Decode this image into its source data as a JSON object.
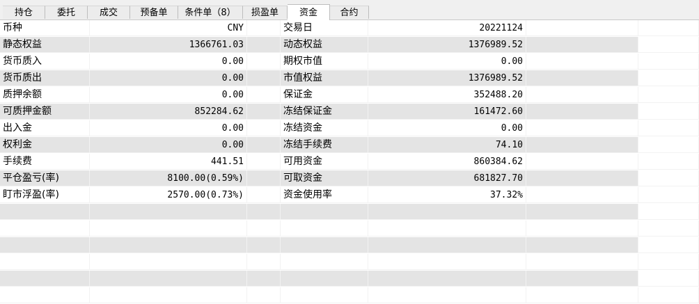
{
  "tabs": [
    {
      "label": "持仓",
      "active": false
    },
    {
      "label": "委托",
      "active": false
    },
    {
      "label": "成交",
      "active": false
    },
    {
      "label": "预备单",
      "active": false
    },
    {
      "label": "条件单（8）",
      "active": false
    },
    {
      "label": "损盈单",
      "active": false
    },
    {
      "label": "资金",
      "active": true
    },
    {
      "label": "合约",
      "active": false
    }
  ],
  "funds": {
    "rows": [
      {
        "l1": "币种",
        "v1": "CNY",
        "l2": "交易日",
        "v2": "20221124"
      },
      {
        "l1": "静态权益",
        "v1": "1366761.03",
        "l2": "动态权益",
        "v2": "1376989.52"
      },
      {
        "l1": "货币质入",
        "v1": "0.00",
        "l2": "期权市值",
        "v2": "0.00"
      },
      {
        "l1": "货币质出",
        "v1": "0.00",
        "l2": "市值权益",
        "v2": "1376989.52"
      },
      {
        "l1": "质押余额",
        "v1": "0.00",
        "l2": "保证金",
        "v2": "352488.20"
      },
      {
        "l1": "可质押金额",
        "v1": "852284.62",
        "l2": "冻结保证金",
        "v2": "161472.60"
      },
      {
        "l1": "出入金",
        "v1": "0.00",
        "l2": "冻结资金",
        "v2": "0.00"
      },
      {
        "l1": "权利金",
        "v1": "0.00",
        "l2": "冻结手续费",
        "v2": "74.10"
      },
      {
        "l1": "手续费",
        "v1": "441.51",
        "l2": "可用资金",
        "v2": "860384.62"
      },
      {
        "l1": "平仓盈亏(率)",
        "v1": "8100.00(0.59%)",
        "l2": "可取资金",
        "v2": "681827.70"
      },
      {
        "l1": "盯市浮盈(率)",
        "v1": "2570.00(0.73%)",
        "l2": "资金使用率",
        "v2": "37.32%"
      },
      {
        "l1": "",
        "v1": "",
        "l2": "",
        "v2": ""
      },
      {
        "l1": "",
        "v1": "",
        "l2": "",
        "v2": ""
      },
      {
        "l1": "",
        "v1": "",
        "l2": "",
        "v2": ""
      },
      {
        "l1": "",
        "v1": "",
        "l2": "",
        "v2": ""
      },
      {
        "l1": "",
        "v1": "",
        "l2": "",
        "v2": ""
      },
      {
        "l1": "",
        "v1": "",
        "l2": "",
        "v2": ""
      }
    ]
  }
}
